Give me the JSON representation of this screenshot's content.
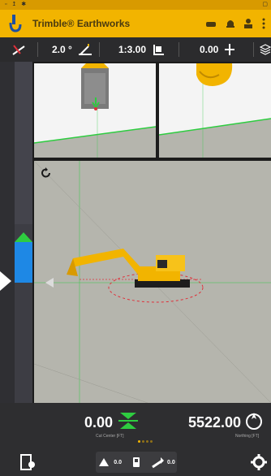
{
  "app": {
    "title": "Trimble® Earthworks"
  },
  "toolbar": {
    "slope_value": "2.0 °",
    "ratio_value": "1:3.00",
    "offset_value": "0.00"
  },
  "readouts": {
    "cut": {
      "value": "0.00",
      "label": "Cut Center [FT]"
    },
    "northing": {
      "value": "5522.00",
      "label": "Northing [FT]"
    }
  },
  "bottom_nav": {
    "mode_value": "0.0",
    "bucket_value": "0.0"
  },
  "colors": {
    "brand_yellow": "#f2b400",
    "design_green": "#2ecc40",
    "terrain_gray": "#b5b5ad",
    "sky_white": "#f4f4f4"
  }
}
